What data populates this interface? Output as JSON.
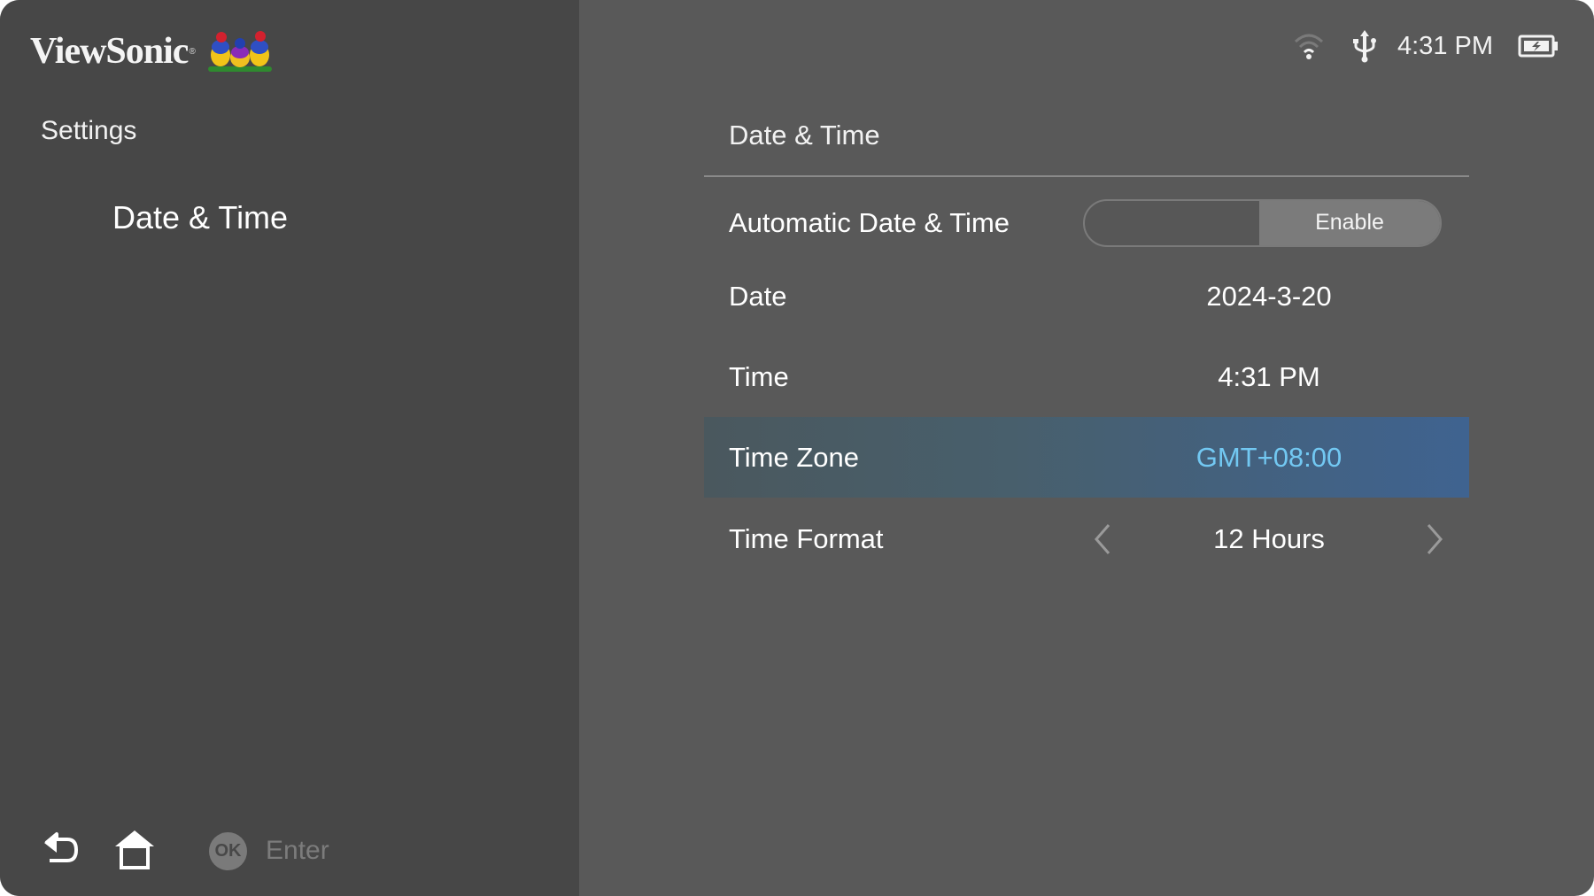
{
  "brand": {
    "name": "ViewSonic",
    "registered_mark": "®",
    "logo_icon": "viewsonic-birds-logo"
  },
  "status_bar": {
    "wifi_icon": "wifi-icon",
    "usb_icon": "usb-icon",
    "time": "4:31 PM",
    "battery_icon": "battery-charging-icon"
  },
  "sidebar": {
    "title": "Settings",
    "items": [
      {
        "label": "Date & Time",
        "selected": true
      }
    ]
  },
  "footer": {
    "back_icon": "back-icon",
    "home_icon": "home-icon",
    "ok_badge": "OK",
    "ok_label": "Enter"
  },
  "panel": {
    "title": "Date & Time",
    "rows": [
      {
        "label": "Automatic Date & Time",
        "type": "toggle",
        "value": "Enable"
      },
      {
        "label": "Date",
        "type": "value",
        "value": "2024-3-20"
      },
      {
        "label": "Time",
        "type": "value",
        "value": "4:31 PM"
      },
      {
        "label": "Time Zone",
        "type": "value",
        "value": "GMT+08:00",
        "focused": true
      },
      {
        "label": "Time Format",
        "type": "selector",
        "value": "12 Hours"
      }
    ]
  },
  "colors": {
    "sidebar_bg": "#474747",
    "panel_bg": "#595959",
    "focus_gradient_start": "#4a585e",
    "focus_gradient_end": "#3f6390",
    "focus_value": "#72c8f2"
  }
}
